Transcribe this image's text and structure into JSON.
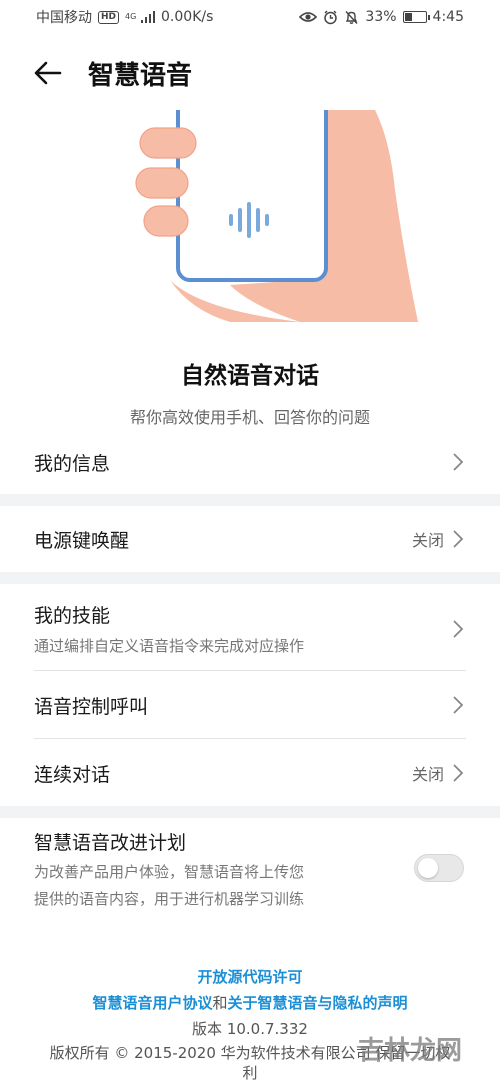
{
  "status_bar": {
    "carrier": "中国移动",
    "hd": "HD",
    "network": "4G",
    "speed": "0.00K/s",
    "battery": "33%",
    "battery_level": 0.33,
    "time": "4:45",
    "icons": [
      "eye-comfort-icon",
      "alarm-icon",
      "mute-bell-icon"
    ]
  },
  "header": {
    "title": "智慧语音"
  },
  "hero": {
    "title": "自然语音对话",
    "subtitle": "帮你高效使用手机、回答你的问题"
  },
  "settings": {
    "my_info": {
      "label": "我的信息"
    },
    "power_key_wake": {
      "label": "电源键唤醒",
      "value": "关闭"
    },
    "my_skills": {
      "label": "我的技能",
      "description": "通过编排自定义语音指令来完成对应操作"
    },
    "voice_call": {
      "label": "语音控制呼叫"
    },
    "continuous_dialog": {
      "label": "连续对话",
      "value": "关闭"
    },
    "improvement_plan": {
      "label": "智慧语音改进计划",
      "description_line1": "为改善产品用户体验，智慧语音将上传您",
      "description_line2": "提供的语音内容，用于进行机器学习训练",
      "enabled": false
    }
  },
  "footer": {
    "open_source": "开放源代码许可",
    "user_agreement": "智慧语音用户协议",
    "and": "和",
    "privacy": "关于智慧语音与隐私的声明",
    "version": "版本  10.0.7.332",
    "copyright": "版权所有 © 2015-2020 华为软件技术有限公司 保留一切权",
    "copyright_tail": "利"
  },
  "watermark": "吉林龙网",
  "colors": {
    "link": "#1b8fd6",
    "separator": "#f1f3f5"
  }
}
